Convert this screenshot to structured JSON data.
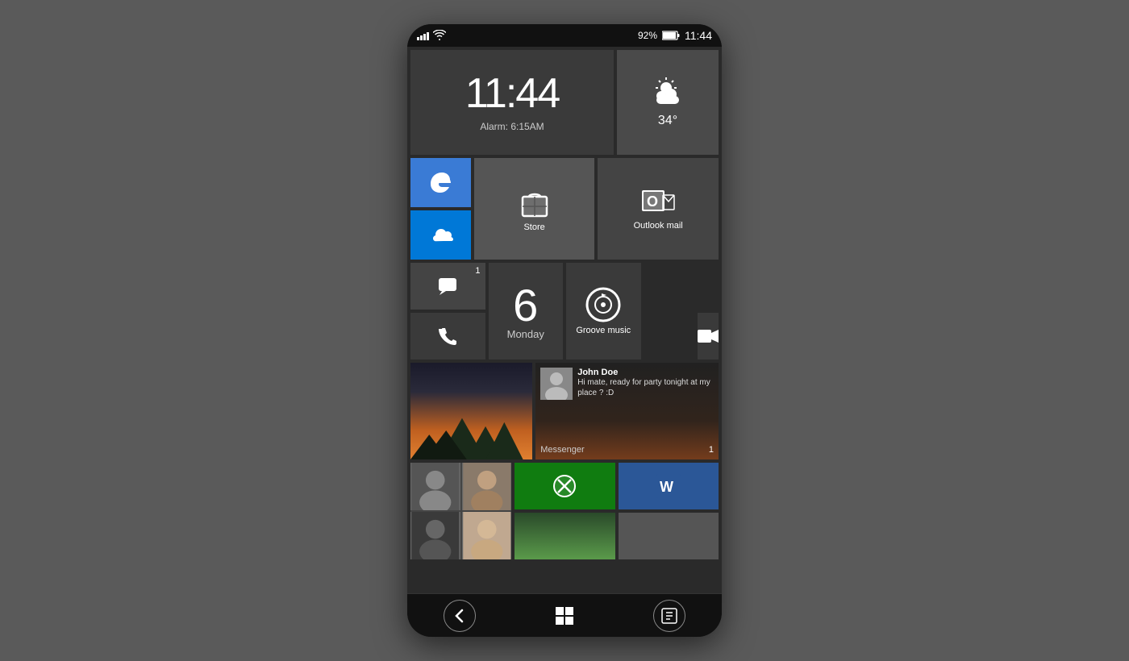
{
  "statusBar": {
    "battery": "92%",
    "time": "11:44"
  },
  "tiles": {
    "clock": {
      "time": "11:44",
      "alarm": "Alarm: 6:15AM"
    },
    "weather": {
      "temp": "34°"
    },
    "store": {
      "label": "Store"
    },
    "outlook": {
      "label": "Outlook mail"
    },
    "calendar": {
      "number": "6",
      "day": "Monday"
    },
    "groove": {
      "label": "Groove music"
    },
    "messenger": {
      "contact": "John Doe",
      "message": "Hi mate, ready for party tonight at my place ? :D",
      "label": "Messenger",
      "count": "1"
    }
  },
  "nav": {
    "back": "←",
    "windows": "⊞",
    "search": "◻"
  }
}
